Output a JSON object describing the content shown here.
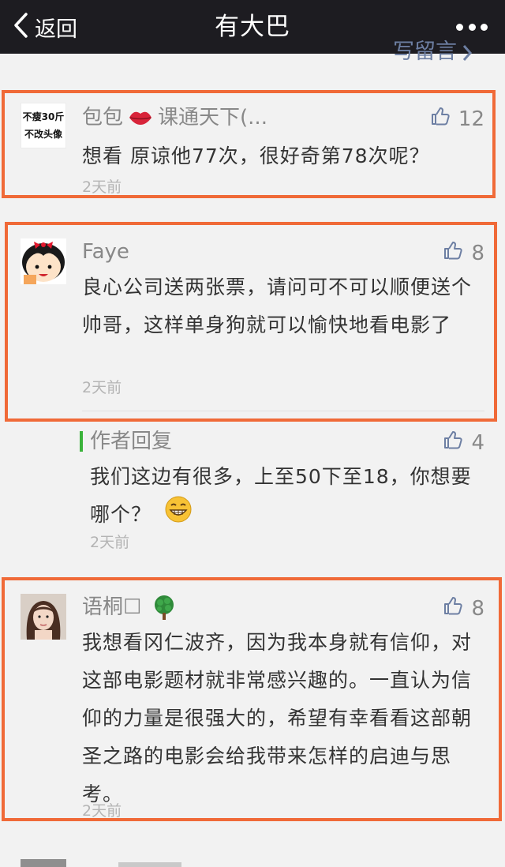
{
  "topbar": {
    "back_label": "返回",
    "title": "有大巴"
  },
  "write_link": {
    "label": "写留言"
  },
  "comments": [
    {
      "nickname": "包包",
      "nickname_tail": "课通天下(...",
      "likes": "12",
      "text": "想看 原谅他77次，很好奇第78次呢？",
      "time": "2天前",
      "avatar_text": [
        "不瘦30斤",
        "不改头像"
      ]
    },
    {
      "nickname": "Faye",
      "likes": "8",
      "text": "良心公司送两张票，请问可不可以顺便送个帅哥，这样单身狗就可以愉快地看电影了",
      "time": "2天前"
    },
    {
      "nickname": "语桐☐",
      "likes": "8",
      "text": "我想看冈仁波齐，因为我本身就有信仰，对这部电影题材就非常感兴趣的。一直认为信仰的力量是很强大的，希望有幸看看这部朝圣之路的电影会给我带来怎样的启迪与思考。",
      "time": "2天前"
    }
  ],
  "reply": {
    "title": "作者回复",
    "likes": "4",
    "text": "我们这边有很多，上至50下至18，你想要哪个？",
    "time": "2天前"
  },
  "colors": {
    "topbar": "#1d1c21",
    "highlight": "#f06a38",
    "reply_accent": "#3bb33b",
    "link": "#6d7fa3"
  }
}
